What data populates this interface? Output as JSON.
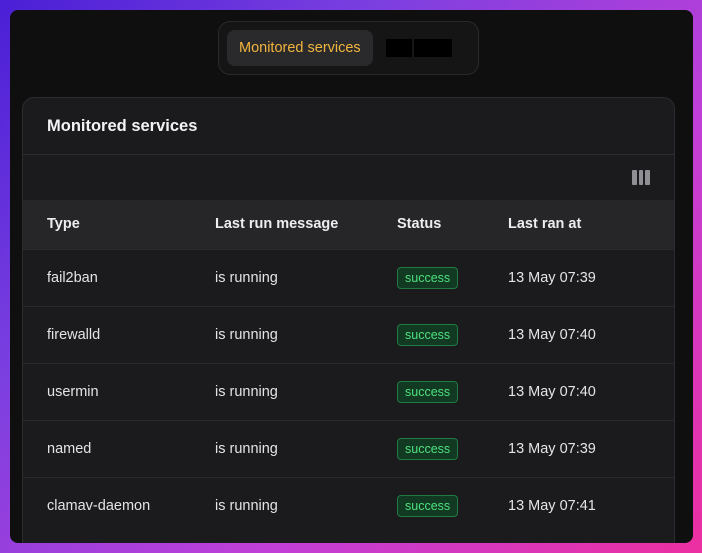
{
  "tabs": {
    "active_label": "Monitored services"
  },
  "card": {
    "title": "Monitored services",
    "toolbar_icon": "columns-icon"
  },
  "table": {
    "headers": [
      "Type",
      "Last run message",
      "Status",
      "Last ran at"
    ],
    "rows": [
      {
        "type": "fail2ban",
        "message": "is running",
        "status": "success",
        "ran_at": "13 May 07:39"
      },
      {
        "type": "firewalld",
        "message": "is running",
        "status": "success",
        "ran_at": "13 May 07:40"
      },
      {
        "type": "usermin",
        "message": "is running",
        "status": "success",
        "ran_at": "13 May 07:40"
      },
      {
        "type": "named",
        "message": "is running",
        "status": "success",
        "ran_at": "13 May 07:39"
      },
      {
        "type": "clamav-daemon",
        "message": "is running",
        "status": "success",
        "ran_at": "13 May 07:41"
      }
    ]
  },
  "colors": {
    "accent": "#f2b53c",
    "success_text": "#4ee07f",
    "success_bg": "#123a22",
    "success_border": "#1f7a43"
  }
}
